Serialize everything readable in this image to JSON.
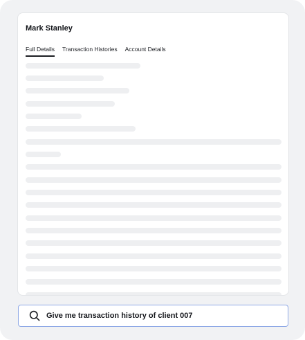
{
  "profile": {
    "name": "Mark Stanley"
  },
  "tabs": [
    {
      "label": "Full Details",
      "active": true
    },
    {
      "label": "Transaction Histories",
      "active": false
    },
    {
      "label": "Account Details",
      "active": false
    }
  ],
  "search": {
    "value": "Give me transaction history of client 007",
    "icon": "search-icon"
  },
  "colors": {
    "skeleton": "#eeeff1",
    "search_border": "#8fa9e6",
    "background": "#f1f2f4"
  }
}
